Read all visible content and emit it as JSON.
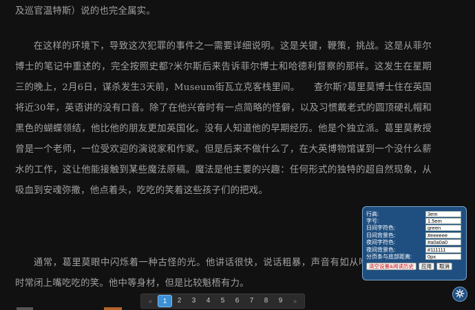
{
  "content": {
    "paragraphs": [
      "及巡官温特斯）说的也完全属实。",
      "在这样的环境下，导致这次犯罪的事件之一需要详细说明。这是关键，鞭策，挑战。这是从菲尔博士的笔记中重述的，完全按照史都?米尔斯后来告诉菲尔博士和哈德利督察的那样。这发生在星期三的晚上，2月6日，谋杀发生3天前，Museum街瓦立克客栈里间。　　查尔斯?葛里莫博士住在英国将近30年，英语讲的没有口音。除了在他兴奋时有一点简略的怪僻，以及习惯戴老式的圆顶硬礼帽和黑色的蝴蝶领结，他比他的朋友更加英国化。没有人知道他的早期经历。他是个独立派。葛里莫教授曾是一个老师，一位受欢迎的演说家和作家。但是后来不做什么了，在大英博物馆谋到一个没什么薪水的工作，这让他能接触到某些魔法原稿。魔法是他主要的兴趣：任何形式的独特的超自然现象，从吸血到安魂弥撒，他点着头，吃吃的笑着这些孩子们的把戏。",
      "通常，葛里莫眼中闪烁着一种古怪的光。他讲话很快，说话粗暴，声音有如从喉咙深处发出，还时常闭上嘴吃吃的笑。他中等身材，但是比较魁梧有力。"
    ]
  },
  "pagination": {
    "prev": "«",
    "pages": [
      "1",
      "2",
      "3",
      "4",
      "5",
      "6",
      "7",
      "8",
      "9"
    ],
    "current": "1",
    "next": "»"
  },
  "settings": {
    "fields": [
      {
        "label": "行高:",
        "value": "3em"
      },
      {
        "label": "字号:",
        "value": "1.5em"
      },
      {
        "label": "日间字符色:",
        "value": "green"
      },
      {
        "label": "日间背景色:",
        "value": "#eeeeee"
      },
      {
        "label": "夜间字符色:",
        "value": "#a0a0a0"
      },
      {
        "label": "夜间背景色:",
        "value": "#111111"
      },
      {
        "label": "分页条与底部距离:",
        "value": "0px"
      }
    ],
    "clear_label": "清空设置&阅读历史",
    "apply_label": "应用",
    "cancel_label": "取消"
  },
  "colors": {
    "background": "#111111",
    "text": "#a0a0a0",
    "panel": "#1f4f80",
    "active_page": "#3d8fd6",
    "danger": "#d01010"
  },
  "icons": {
    "settings_toggle": "gear-icon"
  }
}
